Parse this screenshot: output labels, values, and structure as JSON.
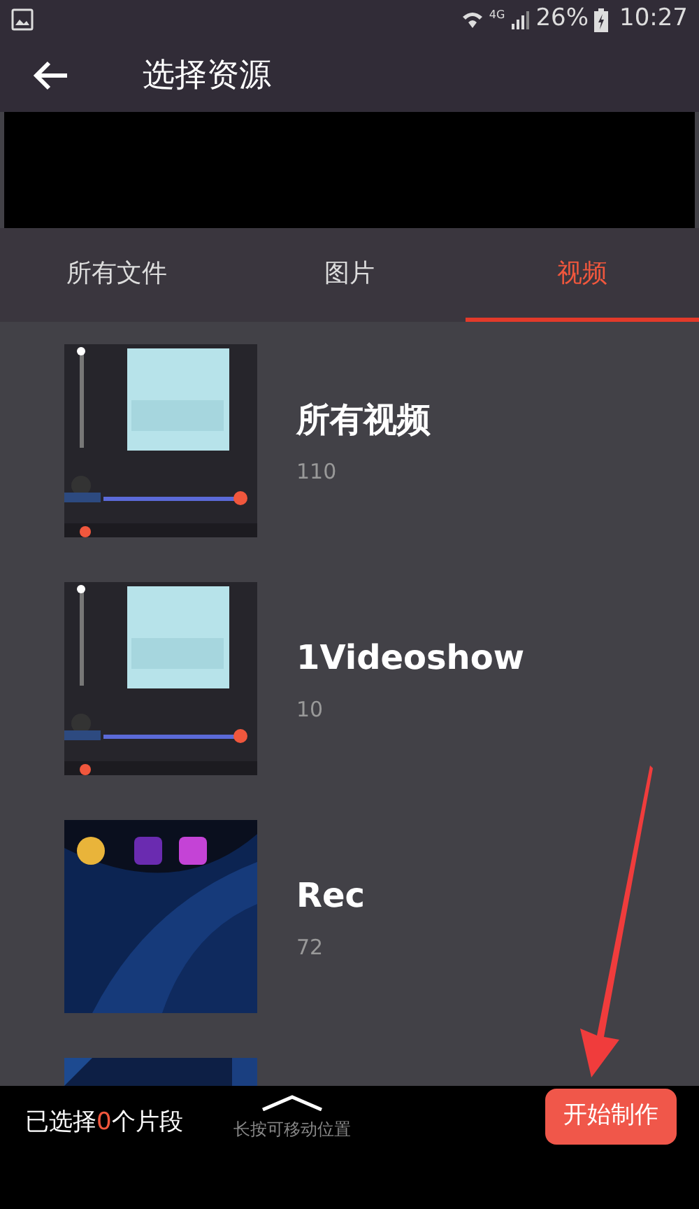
{
  "status_bar": {
    "network": "4G",
    "battery": "26%",
    "time": "10:27"
  },
  "app_bar": {
    "title": "选择资源"
  },
  "tabs": [
    {
      "label": "所有文件",
      "selected": false
    },
    {
      "label": "图片",
      "selected": false
    },
    {
      "label": "视频",
      "selected": true
    }
  ],
  "albums": [
    {
      "kind": "editor",
      "name": "所有视频",
      "count": "110"
    },
    {
      "kind": "editor",
      "name": "1Videoshow",
      "count": "10"
    },
    {
      "kind": "home",
      "name": "Rec",
      "count": "72"
    },
    {
      "kind": "dark"
    }
  ],
  "bottom_bar": {
    "selection": {
      "prefix": "已选择",
      "count": "0",
      "suffix": "个片段"
    },
    "hint": "长按可移动位置",
    "start_button": "开始制作"
  }
}
